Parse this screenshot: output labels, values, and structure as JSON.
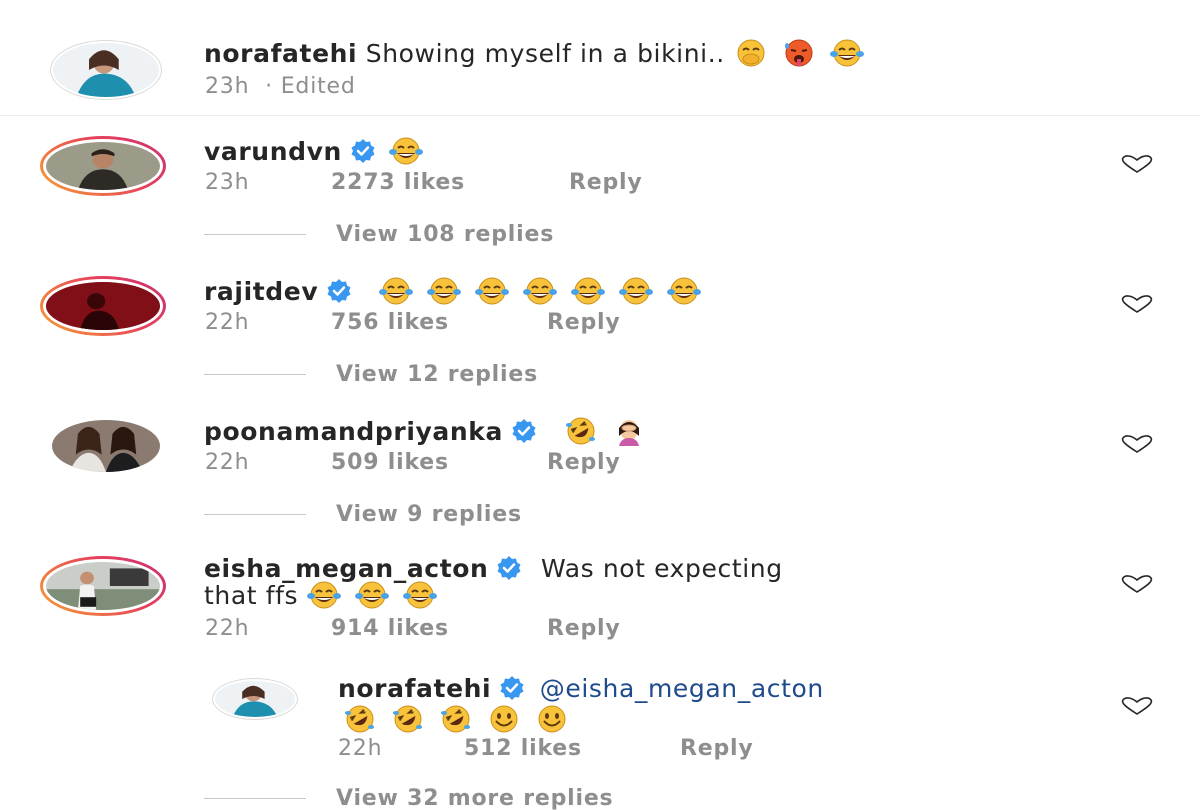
{
  "caption": {
    "username": "norafatehi",
    "text": "Showing myself in a bikini..",
    "emojis": [
      "hand-over-mouth-emoji",
      "hot-face-emoji",
      "tears-of-joy-emoji"
    ],
    "time": "23h",
    "edited": "· Edited"
  },
  "comments": [
    {
      "username": "varundvn",
      "verified": true,
      "text": "",
      "emojis": [
        "tears-of-joy-emoji"
      ],
      "time": "23h",
      "likes": "2273 likes",
      "reply": "Reply",
      "view_replies": "View 108 replies"
    },
    {
      "username": "rajitdev",
      "verified": true,
      "text": "",
      "emojis": [
        "tears-of-joy-emoji",
        "tears-of-joy-emoji",
        "tears-of-joy-emoji",
        "tears-of-joy-emoji",
        "tears-of-joy-emoji",
        "tears-of-joy-emoji",
        "tears-of-joy-emoji"
      ],
      "time": "22h",
      "likes": "756 likes",
      "reply": "Reply",
      "view_replies": "View 12 replies"
    },
    {
      "username": "poonamandpriyanka",
      "verified": true,
      "text": "",
      "emojis": [
        "rolling-on-floor-laughing-emoji",
        "woman-facepalming-emoji"
      ],
      "time": "22h",
      "likes": "509 likes",
      "reply": "Reply",
      "view_replies": "View 9 replies"
    },
    {
      "username": "eisha_megan_acton",
      "verified": true,
      "text": "Was not expecting",
      "text2": "that ffs",
      "emojis": [
        "tears-of-joy-emoji",
        "tears-of-joy-emoji",
        "tears-of-joy-emoji"
      ],
      "time": "22h",
      "likes": "914 likes",
      "reply": "Reply"
    }
  ],
  "reply": {
    "username": "norafatehi",
    "verified": true,
    "mention": "@eisha_megan_acton",
    "emojis": [
      "rolling-on-floor-laughing-emoji",
      "rolling-on-floor-laughing-emoji",
      "rolling-on-floor-laughing-emoji",
      "smiling-face-emoji",
      "smiling-face-emoji"
    ],
    "time": "22h",
    "likes": "512 likes",
    "reply": "Reply",
    "view_more": "View 32 more replies"
  },
  "colors": {
    "verified_blue": "#3897f0",
    "story_ring_start": "#f7a234",
    "story_ring_end": "#c73173",
    "emoji_yellow": "#f8c23a",
    "emoji_tear": "#4aa3e8"
  }
}
